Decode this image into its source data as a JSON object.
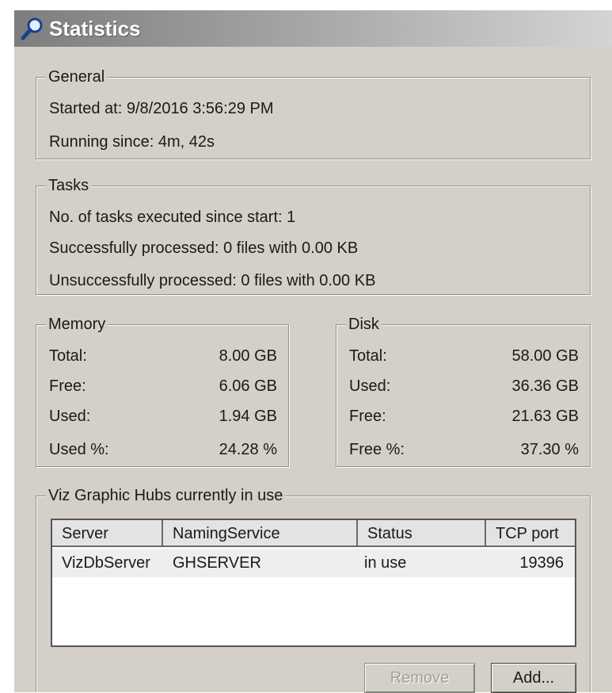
{
  "header": {
    "title": "Statistics",
    "icon": "magnifier-icon"
  },
  "general": {
    "legend": "General",
    "started_at": "Started at: 9/8/2016 3:56:29 PM",
    "running_since": "Running since: 4m, 42s"
  },
  "tasks": {
    "legend": "Tasks",
    "executed": "No. of tasks executed since start: 1",
    "success": "Successfully processed: 0 files with 0.00 KB",
    "failure": "Unsuccessfully processed: 0 files with 0.00 KB"
  },
  "memory": {
    "legend": "Memory",
    "rows": [
      {
        "label": "Total:",
        "value": "8.00 GB"
      },
      {
        "label": "Free:",
        "value": "6.06 GB"
      },
      {
        "label": "Used:",
        "value": "1.94 GB"
      },
      {
        "label": "Used %:",
        "value": "24.28 %"
      }
    ]
  },
  "disk": {
    "legend": "Disk",
    "rows": [
      {
        "label": "Total:",
        "value": "58.00 GB"
      },
      {
        "label": "Used:",
        "value": "36.36 GB"
      },
      {
        "label": "Free:",
        "value": "21.63 GB"
      },
      {
        "label": "Free %:",
        "value": "37.30 %"
      }
    ]
  },
  "hubs": {
    "legend": "Viz Graphic Hubs currently in use",
    "columns": [
      "Server",
      "NamingService",
      "Status",
      "TCP port"
    ],
    "rows": [
      {
        "server": "VizDbServer",
        "naming": "GHSERVER",
        "status": "in use",
        "port": "19396"
      }
    ],
    "remove_label": "Remove",
    "add_label": "Add..."
  }
}
